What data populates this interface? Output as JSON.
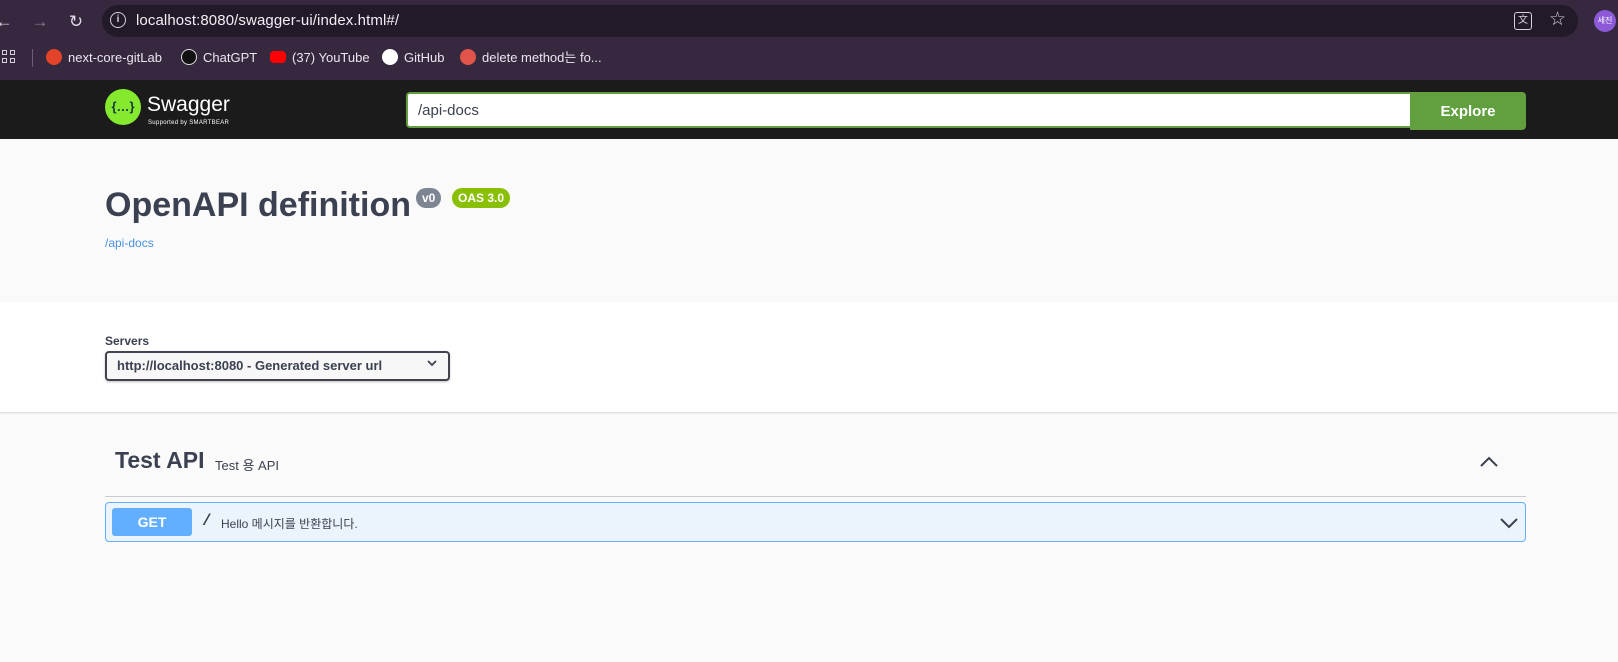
{
  "browser": {
    "url": "localhost:8080/swagger-ui/index.html#/",
    "profile_initials": "세진",
    "bookmarks": [
      {
        "label": "next-core-gitLab",
        "icon": "gitlab-icon",
        "color": "#e24329"
      },
      {
        "label": "ChatGPT",
        "icon": "chatgpt-icon",
        "color": "#111111"
      },
      {
        "label": "(37) YouTube",
        "icon": "youtube-icon",
        "color": "#ff0000"
      },
      {
        "label": "GitHub",
        "icon": "github-icon",
        "color": "#ffffff"
      },
      {
        "label": "delete method는 fo...",
        "icon": "site-icon",
        "color": "#e2544a"
      }
    ]
  },
  "swagger": {
    "brand": "Swagger",
    "brand_sub": "Supported by SMARTBEAR",
    "url_input": "/api-docs",
    "explore_label": "Explore"
  },
  "info": {
    "title": "OpenAPI definition",
    "version_badge": "v0",
    "oas_badge": "OAS 3.0",
    "link": "/api-docs"
  },
  "servers": {
    "label": "Servers",
    "selected": "http://localhost:8080 - Generated server url"
  },
  "tag": {
    "name": "Test API",
    "description": "Test 용 API",
    "operations": [
      {
        "method": "GET",
        "path": "/",
        "summary": "Hello 메시지를 반환합니다."
      }
    ]
  },
  "colors": {
    "swagger_green": "#62a03f",
    "get_blue": "#61affe",
    "oas_badge": "#89bf04",
    "version_badge": "#7d8492"
  }
}
